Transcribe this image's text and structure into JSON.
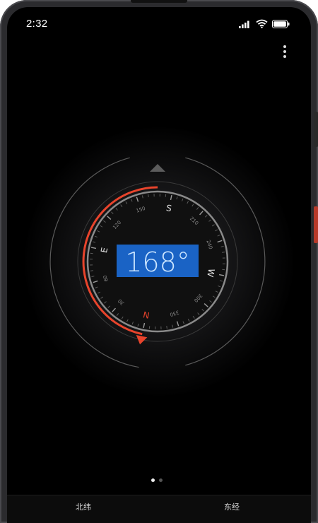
{
  "status_bar": {
    "time": "2:32",
    "icons": [
      "signal-icon",
      "wifi-icon",
      "battery-icon"
    ]
  },
  "toolbar": {
    "more_icon": "more-vertical-icon"
  },
  "compass": {
    "heading_value": 168,
    "heading_display": "168°",
    "directions": {
      "north": "N",
      "south": "S",
      "east": "E",
      "west": "W"
    },
    "degree_labels": [
      "30",
      "60",
      "120",
      "150",
      "210",
      "240",
      "300",
      "330"
    ],
    "colors": {
      "accent": "#e8442c",
      "display_bg": "#1a63c5",
      "display_text": "#c9e4ff",
      "ring": "#8a8a8a",
      "label": "#bcbcbc"
    }
  },
  "pager": {
    "count": 2,
    "active_index": 0
  },
  "coordinates": {
    "latitude": {
      "label": "北纬",
      "value": ""
    },
    "longitude": {
      "label": "东经",
      "value": ""
    }
  }
}
